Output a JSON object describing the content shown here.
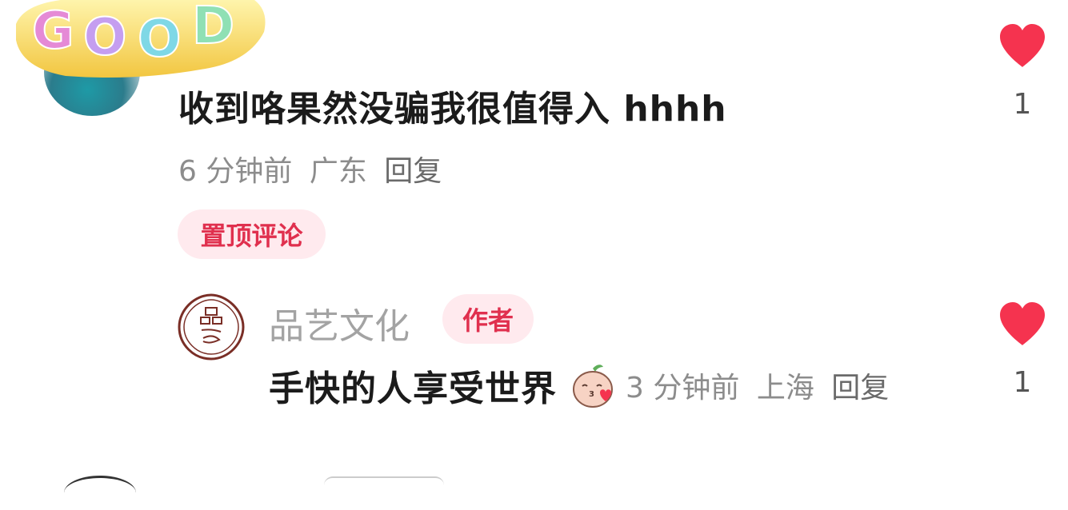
{
  "comment": {
    "text": "收到咯果然没骗我很值得入 hhhh",
    "time": "6 分钟前",
    "location": "广东",
    "reply_label": "回复",
    "pinned_label": "置顶评论",
    "like_count": "1"
  },
  "author_reply": {
    "name": "品艺文化",
    "badge": "作者",
    "text": "手快的人享受世界",
    "time": "3 分钟前",
    "location": "上海",
    "reply_label": "回复",
    "like_count": "1"
  },
  "sticker_text": "GOOD",
  "colors": {
    "heart": "#f5334f",
    "badge_bg": "#ffeaee",
    "badge_text": "#e0304e",
    "meta_text": "#8c8c8c"
  }
}
